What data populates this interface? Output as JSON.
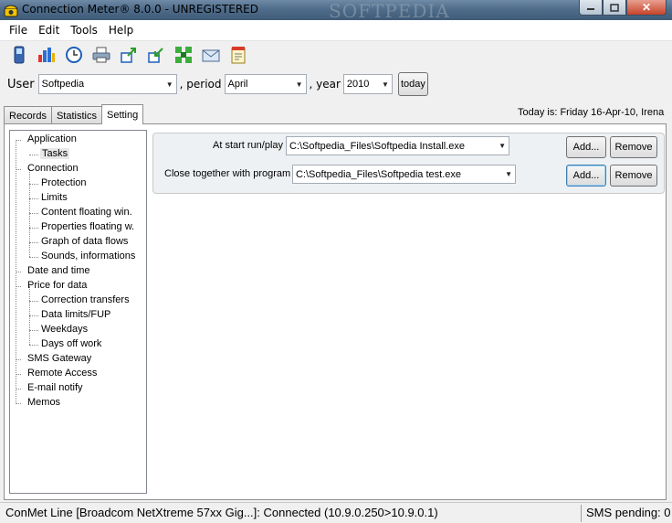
{
  "window": {
    "title": "Connection Meter® 8.0.0 - UNREGISTERED",
    "watermark": "SOFTPEDIA",
    "close_glyph": "✕"
  },
  "menu": [
    "File",
    "Edit",
    "Tools",
    "Help"
  ],
  "toolbar_icons": [
    "phone-icon",
    "bar-chart-icon",
    "clock-icon",
    "printer-icon",
    "export-icon",
    "import-icon",
    "network-icon",
    "mail-icon",
    "notes-icon"
  ],
  "user_row": {
    "user_label": "User",
    "user_value": "Softpedia",
    "period_label": ", period",
    "period_value": "April",
    "year_label": ", year",
    "year_value": "2010",
    "today_button": "today"
  },
  "tabs": [
    "Records",
    "Statistics",
    "Setting"
  ],
  "active_tab": "Setting",
  "today_text": "Today is: Friday 16-Apr-10, Irena",
  "tree": {
    "application": "Application",
    "tasks": "Tasks",
    "connection": "Connection",
    "protection": "Protection",
    "limits": "Limits",
    "content_floating": "Content floating win.",
    "properties_floating": "Properties floating w.",
    "graph_flows": "Graph of data flows",
    "sounds": "Sounds, informations",
    "date_time": "Date and time",
    "price": "Price for data",
    "correction": "Correction transfers",
    "data_limits": "Data limits/FUP",
    "weekdays": "Weekdays",
    "days_off": "Days off work",
    "sms": "SMS Gateway",
    "remote": "Remote Access",
    "email": "E-mail notify",
    "memos": "Memos"
  },
  "tasks": {
    "start_label": "At start run/play",
    "start_value": "C:\\Softpedia_Files\\Softpedia Install.exe",
    "close_label": "Close together with program",
    "close_value": "C:\\Softpedia_Files\\Softpedia test.exe",
    "add_label": "Add...",
    "remove_label": "Remove"
  },
  "status": {
    "line": "ConMet Line [Broadcom NetXtreme 57xx Gig...]: Connected (10.9.0.250>10.9.0.1)",
    "sms": "SMS pending: 0"
  },
  "colors": {
    "title_bar": "#4f6c8a",
    "close_button": "#c7432a",
    "focus_button": "#3c7fb1"
  }
}
